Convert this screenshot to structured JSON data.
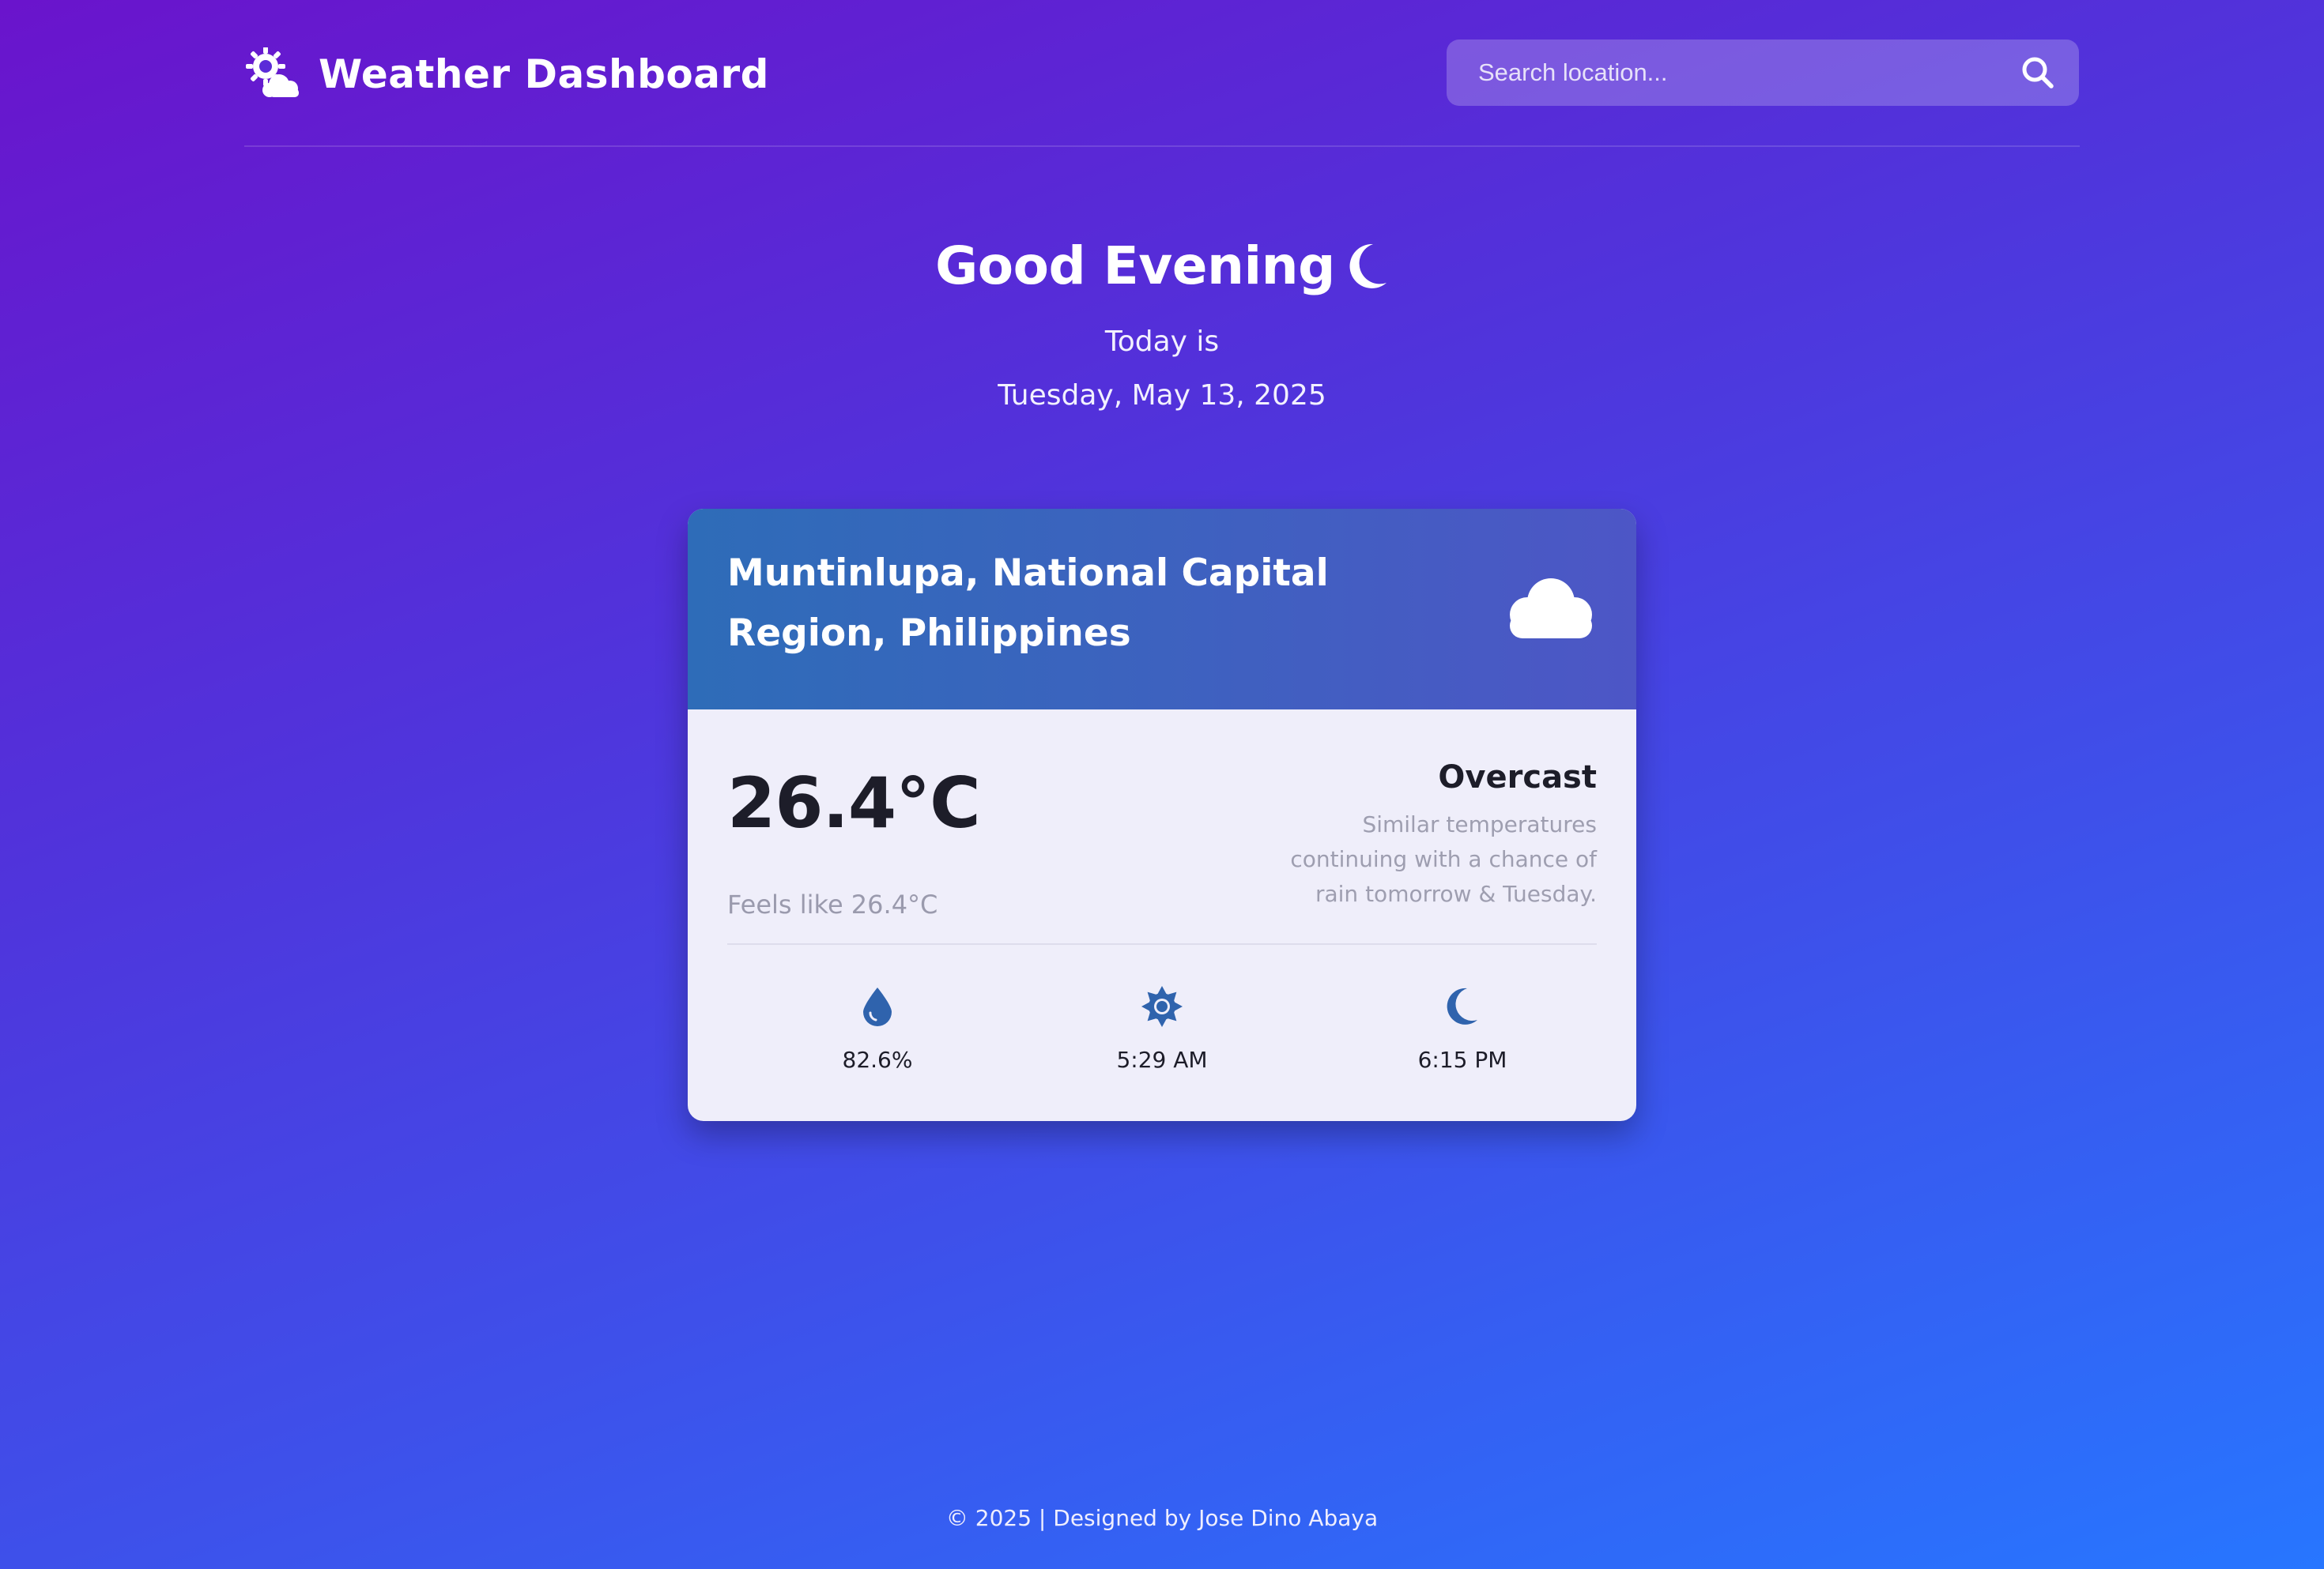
{
  "header": {
    "title": "Weather Dashboard",
    "logo_icon": "sun-cloud-icon",
    "search": {
      "placeholder": "Search location...",
      "value": "",
      "icon": "search-icon"
    }
  },
  "greeting": {
    "title": "Good Evening",
    "icon": "moon-icon",
    "today_label": "Today is",
    "date": "Tuesday, May 13, 2025"
  },
  "weather_card": {
    "location": "Muntinlupa, National Capital Region, Philippines",
    "condition_icon": "cloud-icon",
    "temperature": "26.4°C",
    "feels_like": "Feels like 26.4°C",
    "condition": "Overcast",
    "forecast": "Similar temperatures continuing with a chance of rain tomorrow & Tuesday.",
    "stats": [
      {
        "icon": "droplet-icon",
        "value": "82.6%"
      },
      {
        "icon": "sunrise-sun-icon",
        "value": "5:29 AM"
      },
      {
        "icon": "sunset-moon-icon",
        "value": "6:15 PM"
      }
    ]
  },
  "footer": {
    "text": "© 2025 | Designed by Jose Dino Abaya"
  },
  "colors": {
    "background_start": "#6a14cc",
    "background_end": "#2776ff",
    "card_header": "#3d62bf",
    "card_body": "#efeefa",
    "icon_accent": "#2f63ad"
  }
}
